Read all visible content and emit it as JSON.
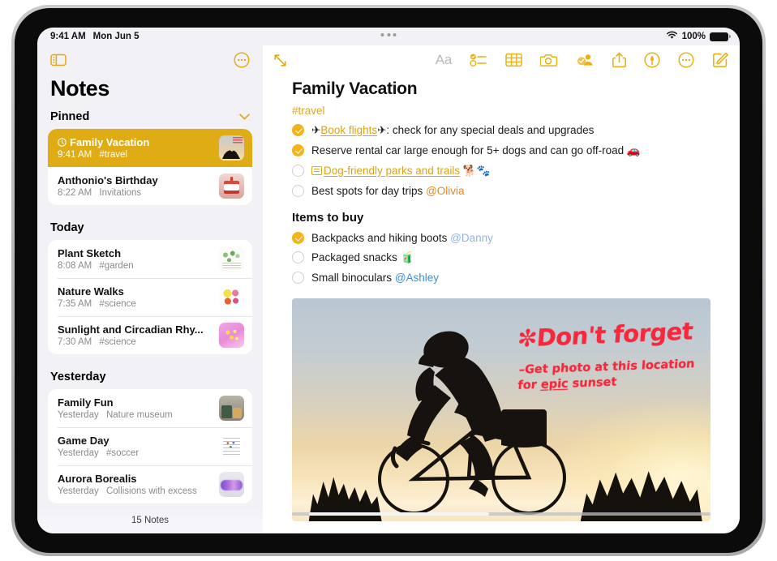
{
  "status_bar": {
    "time": "9:41 AM",
    "date": "Mon Jun 5",
    "wifi_icon": "wifi-icon",
    "battery_percent": "100%",
    "battery_icon": "battery-full-icon"
  },
  "multitask": {
    "icon": "multitasking-dots-icon"
  },
  "sidebar": {
    "toggle_icon": "sidebar-toggle-icon",
    "more_icon": "more-circle-icon",
    "title": "Notes",
    "footer_count": "15 Notes",
    "sections": [
      {
        "title": "Pinned",
        "chevron": "chevron-down-icon",
        "notes": [
          {
            "title": "Family Vacation",
            "time": "9:41 AM",
            "detail": "#travel",
            "selected": true,
            "pinned": true,
            "thumb": "bike-sunset-thumb"
          },
          {
            "title": "Anthonio's Birthday",
            "time": "8:22 AM",
            "detail": "Invitations",
            "selected": false,
            "pinned": false,
            "thumb": "birthday-cake-thumb"
          }
        ]
      },
      {
        "title": "Today",
        "chevron": "",
        "notes": [
          {
            "title": "Plant Sketch",
            "time": "8:08 AM",
            "detail": "#garden",
            "selected": false,
            "pinned": false,
            "thumb": "plant-sketch-thumb"
          },
          {
            "title": "Nature Walks",
            "time": "7:35 AM",
            "detail": "#science",
            "selected": false,
            "pinned": false,
            "thumb": "nature-walks-thumb"
          },
          {
            "title": "Sunlight and Circadian Rhy...",
            "time": "7:30 AM",
            "detail": "#science",
            "selected": false,
            "pinned": false,
            "thumb": "sunlight-thumb"
          }
        ]
      },
      {
        "title": "Yesterday",
        "chevron": "",
        "notes": [
          {
            "title": "Family Fun",
            "time": "Yesterday",
            "detail": "Nature museum",
            "selected": false,
            "pinned": false,
            "thumb": "museum-thumb"
          },
          {
            "title": "Game Day",
            "time": "Yesterday",
            "detail": "#soccer",
            "selected": false,
            "pinned": false,
            "thumb": "game-day-thumb"
          },
          {
            "title": "Aurora Borealis",
            "time": "Yesterday",
            "detail": "Collisions with excess",
            "selected": false,
            "pinned": false,
            "thumb": "aurora-thumb"
          }
        ]
      }
    ]
  },
  "detail": {
    "expand_icon": "expand-diagonal-icon",
    "toolbar": [
      {
        "name": "format-text-button",
        "label": "Aa",
        "dimmed": true
      },
      {
        "name": "checklist-button",
        "label": "",
        "dimmed": false
      },
      {
        "name": "table-button",
        "label": "",
        "dimmed": false
      },
      {
        "name": "camera-button",
        "label": "",
        "dimmed": false
      },
      {
        "name": "collaborate-button",
        "label": "",
        "dimmed": false
      },
      {
        "name": "share-button",
        "label": "",
        "dimmed": false
      },
      {
        "name": "markup-button",
        "label": "",
        "dimmed": false
      },
      {
        "name": "more-button",
        "label": "",
        "dimmed": false
      },
      {
        "name": "compose-button",
        "label": "",
        "dimmed": false
      }
    ],
    "note_title": "Family Vacation",
    "note_tag": "#travel",
    "checklist": [
      {
        "checked": true,
        "prefix_emoji": "✈",
        "link_text": "Book flights",
        "suffix_emoji": "✈",
        "text": ": check for any special deals and upgrades",
        "mention": "",
        "trailing_emoji": "",
        "note_link": false
      },
      {
        "checked": true,
        "prefix_emoji": "",
        "link_text": "",
        "suffix_emoji": "",
        "text": "Reserve rental car large enough for 5+ dogs and can go off-road",
        "mention": "",
        "trailing_emoji": "🚗",
        "note_link": false
      },
      {
        "checked": false,
        "prefix_emoji": "",
        "link_text": "Dog-friendly parks and trails",
        "suffix_emoji": "",
        "text": "",
        "mention": "",
        "trailing_emoji": "🐕🐾",
        "note_link": true
      },
      {
        "checked": false,
        "prefix_emoji": "",
        "link_text": "",
        "suffix_emoji": "",
        "text": "Best spots for day trips",
        "mention": "@Olivia",
        "mention_style": "orange",
        "trailing_emoji": "",
        "note_link": false
      }
    ],
    "subheading": "Items to buy",
    "shopping": [
      {
        "checked": true,
        "text": "Backpacks and hiking boots",
        "mention": "@Danny",
        "mention_style": "blue-light",
        "trailing_emoji": ""
      },
      {
        "checked": false,
        "text": "Packaged snacks",
        "mention": "",
        "mention_style": "",
        "trailing_emoji": "🧃"
      },
      {
        "checked": false,
        "text": "Small binoculars",
        "mention": "@Ashley",
        "mention_style": "blue",
        "trailing_emoji": ""
      }
    ],
    "photo": {
      "name": "cyclist-sunset-photo",
      "handwriting_title": "✼Don't forget",
      "handwriting_line1": "–Get photo at this location",
      "handwriting_line2_prefix": "for ",
      "handwriting_line2_underlined": "epic",
      "handwriting_line2_suffix": " sunset"
    }
  },
  "colors": {
    "accent_yellow": "#E9B117",
    "selected_row": "#E0AC16",
    "handwriting_red": "#F6283C",
    "mention_blue": "#3E8EE0",
    "sidebar_bg": "#F2F1F6"
  }
}
